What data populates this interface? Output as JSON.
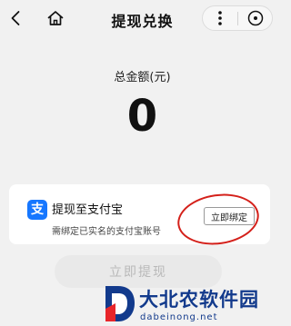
{
  "nav": {
    "title": "提现兑换",
    "back_icon": "chevron-left-icon",
    "home_icon": "home-icon",
    "more_icon": "more-vertical-icon",
    "close_icon": "close-circle-icon"
  },
  "summary": {
    "label": "总金额(元)",
    "amount": "0"
  },
  "alipay_card": {
    "logo_char": "支",
    "logo_color": "#1677ff",
    "title": "提现至支付宝",
    "subtitle": "需绑定已实名的支付宝账号",
    "bind_button": "立即绑定",
    "highlight_color": "#d4201a"
  },
  "withdraw_button": {
    "label": "立即提现",
    "disabled": true
  },
  "watermark": {
    "name": "大北农软件园",
    "url": "dabeinong.net"
  }
}
